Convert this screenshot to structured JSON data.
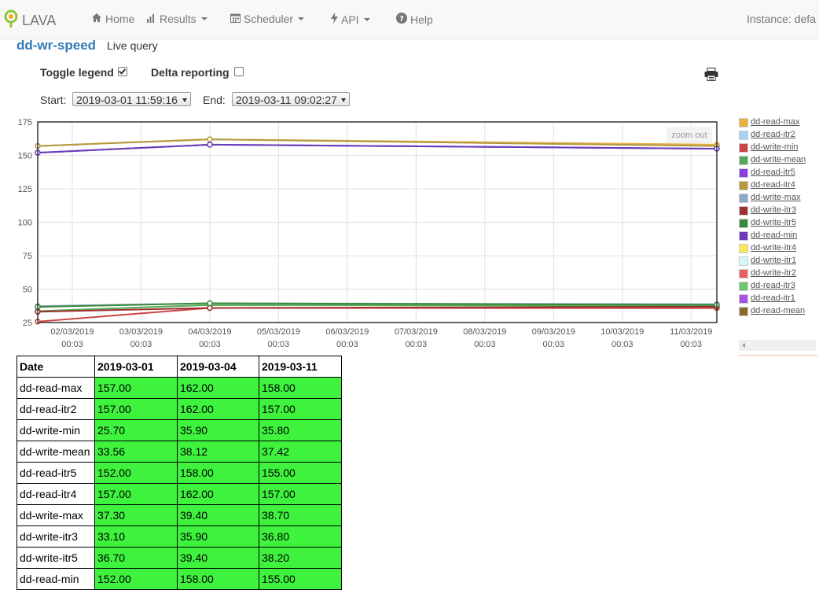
{
  "nav": {
    "brand": "LAVA",
    "items": [
      {
        "label": "Home",
        "icon": "home-icon",
        "dropdown": false
      },
      {
        "label": "Results",
        "icon": "bar-chart-icon",
        "dropdown": true
      },
      {
        "label": "Scheduler",
        "icon": "calendar-icon",
        "dropdown": true
      },
      {
        "label": "API",
        "icon": "bolt-icon",
        "dropdown": true
      },
      {
        "label": "Help",
        "icon": "question-circle-icon",
        "dropdown": false
      }
    ],
    "instance": "Instance: defa"
  },
  "page": {
    "title": "dd-wr-speed",
    "subtitle": "Live query"
  },
  "options": {
    "toggle_legend_label": "Toggle legend",
    "toggle_legend_checked": true,
    "delta_reporting_label": "Delta reporting",
    "delta_reporting_checked": false
  },
  "range": {
    "start_label": "Start:",
    "start_value": "2019-03-01 11:59:16",
    "end_label": "End:",
    "end_value": "2019-03-11 09:02:27"
  },
  "zoom_out_label": "zoom out",
  "chart_data": {
    "type": "line",
    "ylim": [
      25,
      175
    ],
    "yticks": [
      25,
      50,
      75,
      100,
      125,
      150,
      175
    ],
    "xlim": [
      "2019-03-01 11:59",
      "2019-03-11 09:02"
    ],
    "xticks": [
      {
        "date": "02/03/2019",
        "time": "00:03"
      },
      {
        "date": "03/03/2019",
        "time": "00:03"
      },
      {
        "date": "04/03/2019",
        "time": "00:03"
      },
      {
        "date": "05/03/2019",
        "time": "00:03"
      },
      {
        "date": "06/03/2019",
        "time": "00:03"
      },
      {
        "date": "07/03/2019",
        "time": "00:03"
      },
      {
        "date": "08/03/2019",
        "time": "00:03"
      },
      {
        "date": "09/03/2019",
        "time": "00:03"
      },
      {
        "date": "10/03/2019",
        "time": "00:03"
      },
      {
        "date": "11/03/2019",
        "time": "00:03"
      }
    ],
    "x": [
      "2019-03-01",
      "2019-03-04",
      "2019-03-11"
    ],
    "grid": true,
    "legend": "right",
    "series": [
      {
        "name": "dd-read-max",
        "color": "#e8b03c",
        "values": [
          157.0,
          162.0,
          158.0
        ]
      },
      {
        "name": "dd-read-itr2",
        "color": "#a8d0f0",
        "values": [
          157.0,
          162.0,
          157.0
        ]
      },
      {
        "name": "dd-write-min",
        "color": "#cc4444",
        "values": [
          25.7,
          35.9,
          35.8
        ]
      },
      {
        "name": "dd-write-mean",
        "color": "#55aa55",
        "values": [
          33.56,
          38.12,
          37.42
        ]
      },
      {
        "name": "dd-read-itr5",
        "color": "#8a3ee0",
        "values": [
          152.0,
          158.0,
          155.0
        ]
      },
      {
        "name": "dd-read-itr4",
        "color": "#b8983a",
        "values": [
          157.0,
          162.0,
          157.0
        ]
      },
      {
        "name": "dd-write-max",
        "color": "#8aa6c8",
        "values": [
          37.3,
          39.4,
          38.7
        ]
      },
      {
        "name": "dd-write-itr3",
        "color": "#a03030",
        "values": [
          33.1,
          35.9,
          36.8
        ]
      },
      {
        "name": "dd-write-itr5",
        "color": "#3a8a3a",
        "values": [
          36.7,
          39.4,
          38.2
        ]
      },
      {
        "name": "dd-read-min",
        "color": "#6a3cb8",
        "values": [
          152.0,
          158.0,
          155.0
        ]
      },
      {
        "name": "dd-write-itr4",
        "color": "#f8e85a",
        "values": [
          null,
          null,
          null
        ]
      },
      {
        "name": "dd-write-itr1",
        "color": "#d8f8f8",
        "values": [
          null,
          null,
          null
        ]
      },
      {
        "name": "dd-write-itr2",
        "color": "#e86060",
        "values": [
          null,
          null,
          null
        ]
      },
      {
        "name": "dd-read-itr3",
        "color": "#6ac86a",
        "values": [
          null,
          null,
          null
        ]
      },
      {
        "name": "dd-read-itr1",
        "color": "#a850e8",
        "values": [
          null,
          null,
          null
        ]
      },
      {
        "name": "dd-read-mean",
        "color": "#8a6a2a",
        "values": [
          null,
          null,
          null
        ]
      }
    ]
  },
  "table": {
    "headers": [
      "Date",
      "2019-03-01",
      "2019-03-04",
      "2019-03-11"
    ],
    "rows": [
      {
        "name": "dd-read-max",
        "values": [
          "157.00",
          "162.00",
          "158.00"
        ]
      },
      {
        "name": "dd-read-itr2",
        "values": [
          "157.00",
          "162.00",
          "157.00"
        ]
      },
      {
        "name": "dd-write-min",
        "values": [
          "25.70",
          "35.90",
          "35.80"
        ]
      },
      {
        "name": "dd-write-mean",
        "values": [
          "33.56",
          "38.12",
          "37.42"
        ]
      },
      {
        "name": "dd-read-itr5",
        "values": [
          "152.00",
          "158.00",
          "155.00"
        ]
      },
      {
        "name": "dd-read-itr4",
        "values": [
          "157.00",
          "162.00",
          "157.00"
        ]
      },
      {
        "name": "dd-write-max",
        "values": [
          "37.30",
          "39.40",
          "38.70"
        ]
      },
      {
        "name": "dd-write-itr3",
        "values": [
          "33.10",
          "35.90",
          "36.80"
        ]
      },
      {
        "name": "dd-write-itr5",
        "values": [
          "36.70",
          "39.40",
          "38.20"
        ]
      },
      {
        "name": "dd-read-min",
        "values": [
          "152.00",
          "158.00",
          "155.00"
        ]
      }
    ]
  }
}
